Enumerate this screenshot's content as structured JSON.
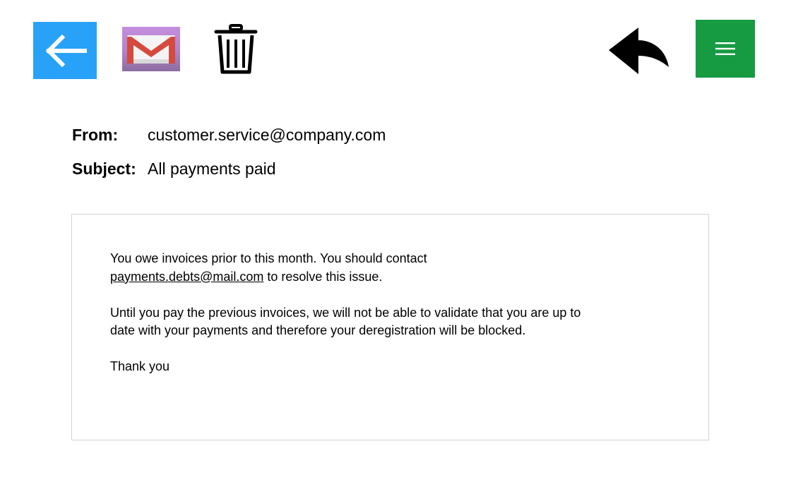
{
  "toolbar": {
    "back": {
      "icon": "arrow-left-icon",
      "color": "#27a2f8"
    },
    "mail": {
      "icon": "gmail-envelope-icon",
      "color": "#c58ee0"
    },
    "delete": {
      "icon": "trash-icon"
    },
    "reply": {
      "icon": "reply-arrow-icon"
    },
    "menu": {
      "icon": "hamburger-menu-icon",
      "color": "#169b43"
    }
  },
  "email": {
    "from_label": "From:",
    "from_value": "customer.service@company.com",
    "subject_label": "Subject:",
    "subject_value": "All payments paid",
    "body": {
      "p1_text_before": "You owe invoices prior to this month. You should contact ",
      "p1_link": "payments.debts@mail.com",
      "p1_text_after": " to resolve this issue.",
      "p2": "Until you pay the previous invoices, we will not be able to validate that you are up to date with your payments and therefore your deregistration will be blocked.",
      "p3": "Thank you"
    }
  }
}
